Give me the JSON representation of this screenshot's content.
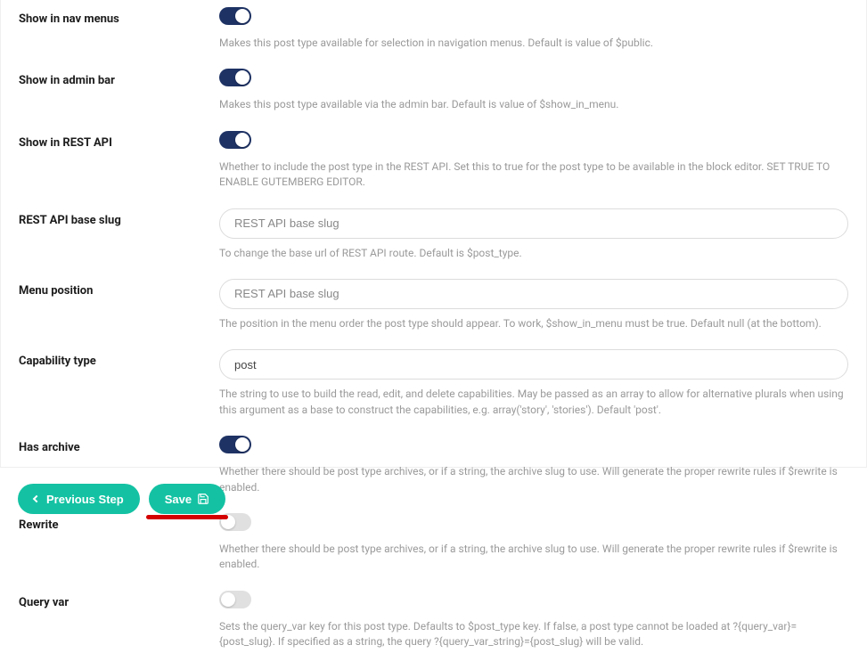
{
  "fields": {
    "show_in_nav_menus": {
      "label": "Show in nav menus",
      "desc": "Makes this post type available for selection in navigation menus. Default is value of $public."
    },
    "show_in_admin_bar": {
      "label": "Show in admin bar",
      "desc": "Makes this post type available via the admin bar. Default is value of $show_in_menu."
    },
    "show_in_rest": {
      "label": "Show in REST API",
      "desc": "Whether to include the post type in the REST API. Set this to true for the post type to be available in the block editor. SET TRUE TO ENABLE GUTEMBERG EDITOR."
    },
    "rest_base": {
      "label": "REST API base slug",
      "placeholder": "REST API base slug",
      "desc": "To change the base url of REST API route. Default is $post_type."
    },
    "menu_position": {
      "label": "Menu position",
      "placeholder": "REST API base slug",
      "desc": "The position in the menu order the post type should appear. To work, $show_in_menu must be true. Default null (at the bottom)."
    },
    "capability_type": {
      "label": "Capability type",
      "value": "post",
      "desc": "The string to use to build the read, edit, and delete capabilities. May be passed as an array to allow for alternative plurals when using this argument as a base to construct the capabilities, e.g. array('story', 'stories'). Default 'post'."
    },
    "has_archive": {
      "label": "Has archive",
      "desc": "Whether there should be post type archives, or if a string, the archive slug to use. Will generate the proper rewrite rules if $rewrite is enabled."
    },
    "rewrite": {
      "label": "Rewrite",
      "desc": "Whether there should be post type archives, or if a string, the archive slug to use. Will generate the proper rewrite rules if $rewrite is enabled."
    },
    "query_var": {
      "label": "Query var",
      "desc": "Sets the query_var key for this post type. Defaults to $post_type key. If false, a post type cannot be loaded at ?{query_var}={post_slug}. If specified as a string, the query ?{query_var_string}={post_slug} will be valid."
    }
  },
  "footer": {
    "previous": "Previous Step",
    "save": "Save"
  }
}
